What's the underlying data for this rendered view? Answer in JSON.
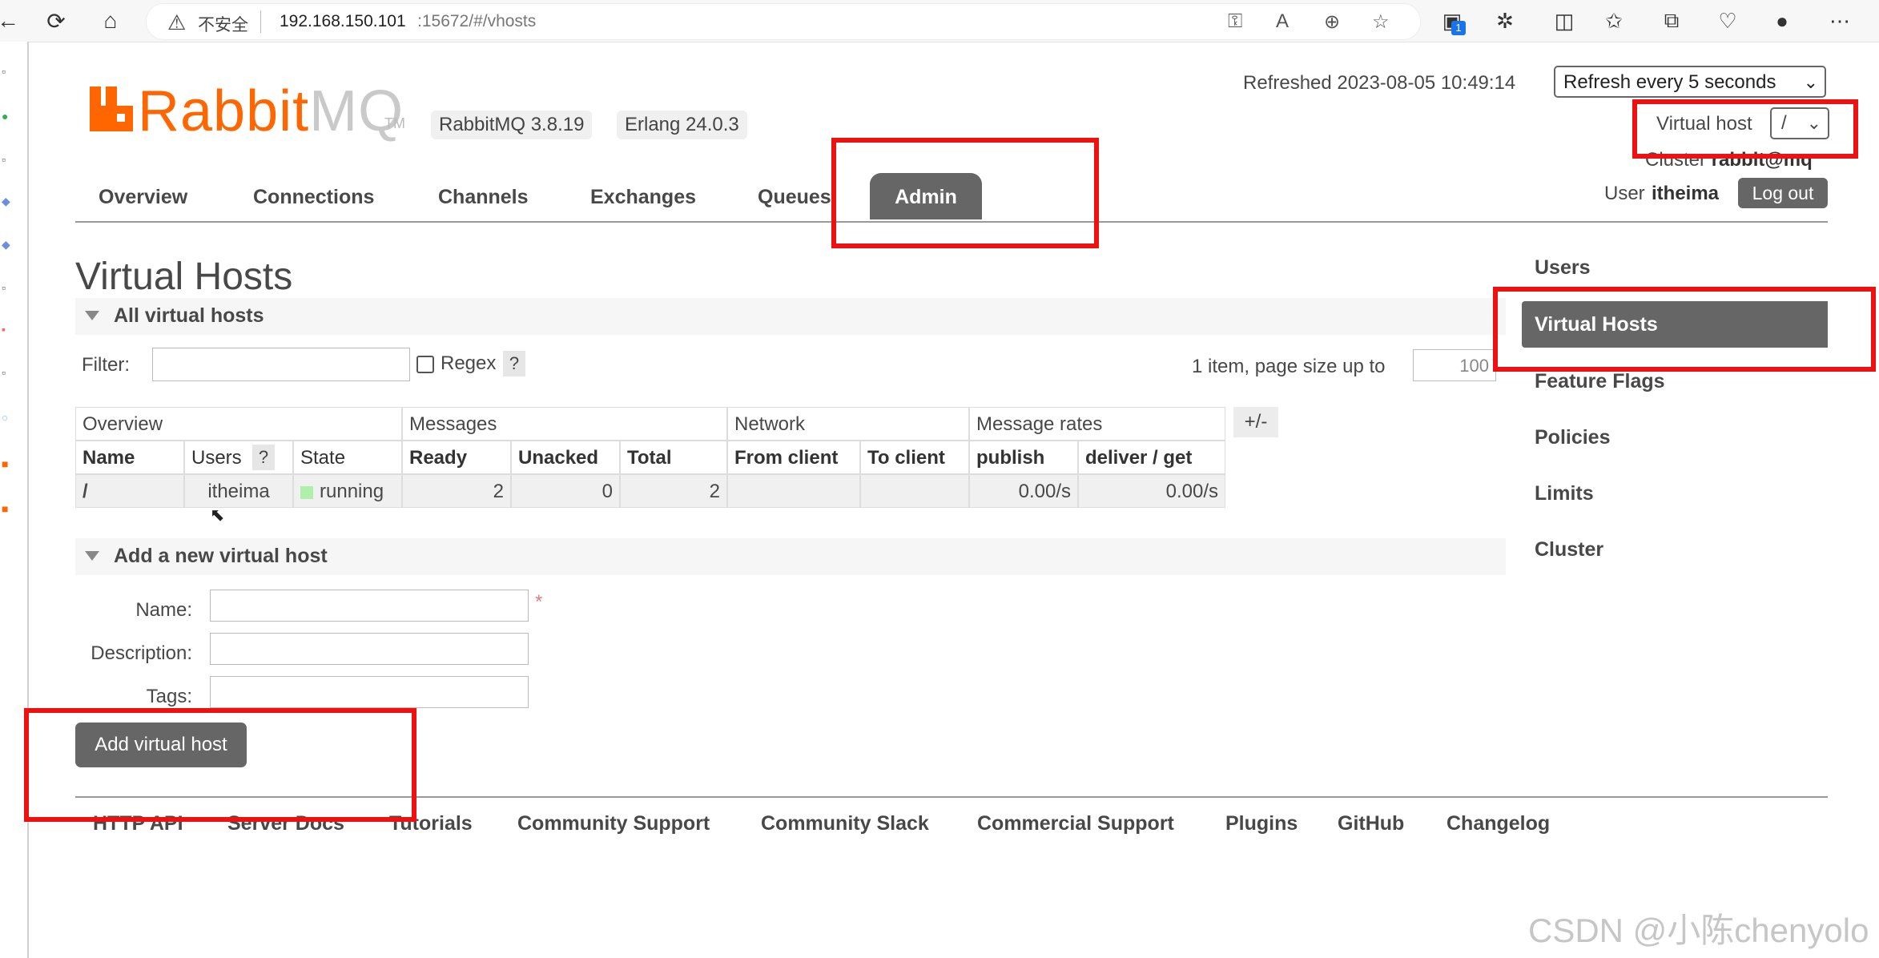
{
  "browser": {
    "security_label": "不安全",
    "url_host": "192.168.150.101",
    "url_rest": ":15672/#/vhosts",
    "tab_badge": "1"
  },
  "header": {
    "logo_rabbit": "Rabbit",
    "logo_mq": "MQ",
    "logo_tm": "TM",
    "version_rabbitmq": "RabbitMQ 3.8.19",
    "version_erlang": "Erlang 24.0.3",
    "refreshed": "Refreshed 2023-08-05 10:49:14",
    "refresh_option": "Refresh every 5 seconds",
    "vhost_label": "Virtual host",
    "vhost_value": "/",
    "cluster_label": "Cluster",
    "cluster_value": "rabbit@mq",
    "user_label": "User",
    "user_name": "itheima",
    "logout": "Log out"
  },
  "tabs": {
    "overview": "Overview",
    "connections": "Connections",
    "channels": "Channels",
    "exchanges": "Exchanges",
    "queues": "Queues",
    "admin": "Admin"
  },
  "main": {
    "title": "Virtual Hosts",
    "section_all": "All virtual hosts",
    "filter_label": "Filter:",
    "regex_label": "Regex",
    "help": "?",
    "items_text": "1 item, page size up to",
    "page_size": "100",
    "plusminus": "+/-"
  },
  "table": {
    "groups": [
      "Overview",
      "Messages",
      "Network",
      "Message rates"
    ],
    "columns": [
      "Name",
      "Users",
      "State",
      "Ready",
      "Unacked",
      "Total",
      "From client",
      "To client",
      "publish",
      "deliver / get"
    ],
    "row": {
      "name": "/",
      "users": "itheima",
      "state": "running",
      "ready": "2",
      "unacked": "0",
      "total": "2",
      "from_client": "",
      "to_client": "",
      "publish": "0.00/s",
      "deliver_get": "0.00/s"
    }
  },
  "add_form": {
    "section": "Add a new virtual host",
    "name_label": "Name:",
    "description_label": "Description:",
    "tags_label": "Tags:",
    "required_mark": "*",
    "submit": "Add virtual host"
  },
  "sidebar": {
    "users": "Users",
    "virtual_hosts": "Virtual Hosts",
    "feature_flags": "Feature Flags",
    "policies": "Policies",
    "limits": "Limits",
    "cluster": "Cluster"
  },
  "footer": {
    "http_api": "HTTP API",
    "server_docs": "Server Docs",
    "tutorials": "Tutorials",
    "community_support": "Community Support",
    "community_slack": "Community Slack",
    "commercial_support": "Commercial Support",
    "plugins": "Plugins",
    "github": "GitHub",
    "changelog": "Changelog"
  },
  "watermark": "CSDN @小陈chenyolo",
  "colors": {
    "brand_orange": "#ff6600",
    "active_gray": "#666666",
    "highlight_red": "#ee1111",
    "running_green": "#aef0aa"
  }
}
